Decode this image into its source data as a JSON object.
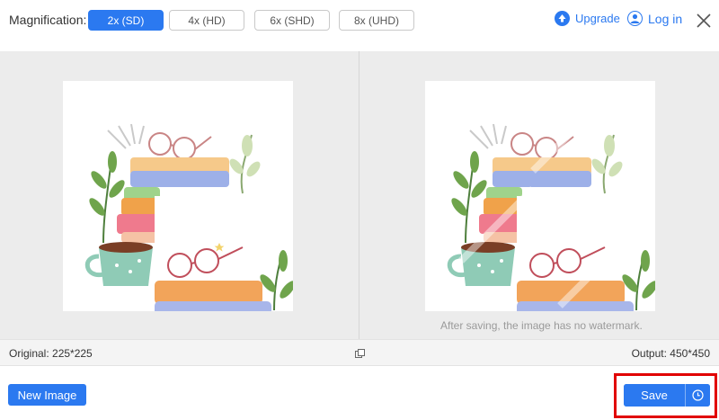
{
  "topbar": {
    "magnification_label": "Magnification:",
    "options": [
      {
        "label": "2x (SD)",
        "active": true
      },
      {
        "label": "4x (HD)",
        "active": false
      },
      {
        "label": "6x (SHD)",
        "active": false
      },
      {
        "label": "8x (UHD)",
        "active": false
      }
    ],
    "upgrade_label": "Upgrade",
    "login_label": "Log in"
  },
  "preview": {
    "no_watermark_note": "After saving, the image has no watermark."
  },
  "infobar": {
    "original_label": "Original: 225*225",
    "output_label": "Output: 450*450"
  },
  "bottombar": {
    "new_image_label": "New Image",
    "save_label": "Save"
  },
  "icons": {
    "upgrade": "upgrade-arrow-icon",
    "login": "user-icon",
    "close": "close-icon",
    "compare": "compare-icon",
    "history": "clock-icon"
  },
  "colors": {
    "accent": "#2b79f0",
    "highlight": "#e10000"
  }
}
